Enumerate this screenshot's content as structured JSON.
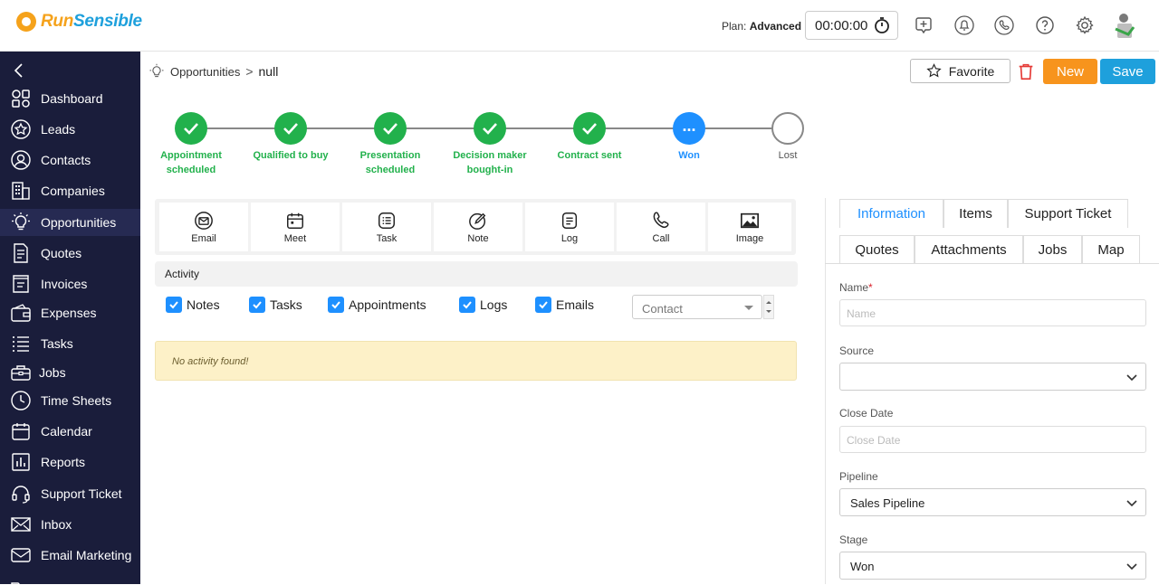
{
  "brand": {
    "part1": "Run",
    "part2": "Sensible"
  },
  "header": {
    "plan_label": "Plan:",
    "plan_value": "Advanced",
    "timer": "00:00:00"
  },
  "sidebar": {
    "items": [
      {
        "label": "Dashboard",
        "icon": "dashboard-icon"
      },
      {
        "label": "Leads",
        "icon": "star-icon"
      },
      {
        "label": "Contacts",
        "icon": "contact-icon"
      },
      {
        "label": "Companies",
        "icon": "building-icon"
      },
      {
        "label": "Opportunities",
        "icon": "lightbulb-icon",
        "active": true
      },
      {
        "label": "Quotes",
        "icon": "document-icon"
      },
      {
        "label": "Invoices",
        "icon": "invoice-icon"
      },
      {
        "label": "Expenses",
        "icon": "wallet-icon"
      },
      {
        "label": "Tasks",
        "icon": "list-icon"
      },
      {
        "label": "Jobs",
        "icon": "toolbox-icon"
      },
      {
        "label": "Time Sheets",
        "icon": "clock-icon"
      },
      {
        "label": "Calendar",
        "icon": "calendar-icon"
      },
      {
        "label": "Reports",
        "icon": "report-icon"
      },
      {
        "label": "Support Ticket",
        "icon": "headset-icon"
      },
      {
        "label": "Inbox",
        "icon": "mail-icon"
      },
      {
        "label": "Email Marketing",
        "icon": "email-marketing-icon"
      }
    ]
  },
  "breadcrumb": {
    "section": "Opportunities",
    "current": "null"
  },
  "toolbar": {
    "favorite_label": "Favorite",
    "new_label": "New",
    "save_label": "Save"
  },
  "pipeline": {
    "stages": [
      {
        "label": "Appointment scheduled",
        "state": "done"
      },
      {
        "label": "Qualified to buy",
        "state": "done"
      },
      {
        "label": "Presentation scheduled",
        "state": "done"
      },
      {
        "label": "Decision maker bought-in",
        "state": "done"
      },
      {
        "label": "Contract sent",
        "state": "done"
      },
      {
        "label": "Won",
        "state": "current",
        "symbol": "..."
      },
      {
        "label": "Lost",
        "state": "todo"
      }
    ]
  },
  "actions": [
    {
      "label": "Email",
      "icon": "envelope-icon"
    },
    {
      "label": "Meet",
      "icon": "calendar-meet-icon"
    },
    {
      "label": "Task",
      "icon": "task-list-icon"
    },
    {
      "label": "Note",
      "icon": "pencil-icon"
    },
    {
      "label": "Log",
      "icon": "log-icon"
    },
    {
      "label": "Call",
      "icon": "phone-icon"
    },
    {
      "label": "Image",
      "icon": "image-icon"
    }
  ],
  "activity": {
    "title": "Activity",
    "filters": [
      "Notes",
      "Tasks",
      "Appointments",
      "Logs",
      "Emails"
    ],
    "contact_placeholder": "Contact",
    "empty_message": "No activity found!"
  },
  "tabs": {
    "row1": [
      {
        "label": "Information",
        "active": true
      },
      {
        "label": "Items"
      },
      {
        "label": "Support Ticket"
      }
    ],
    "row2": [
      {
        "label": "Quotes"
      },
      {
        "label": "Attachments"
      },
      {
        "label": "Jobs"
      },
      {
        "label": "Map"
      }
    ]
  },
  "form": {
    "name_label": "Name",
    "name_required": "*",
    "name_placeholder": "Name",
    "source_label": "Source",
    "source_value": "",
    "close_date_label": "Close Date",
    "close_date_placeholder": "Close Date",
    "pipeline_label": "Pipeline",
    "pipeline_value": "Sales Pipeline",
    "stage_label": "Stage",
    "stage_value": "Won"
  },
  "colors": {
    "sidebar_bg": "#1a1d3b",
    "done": "#22b14c",
    "current": "#1e90ff",
    "new_button": "#f7941d",
    "save_button": "#1ea0dc",
    "brand_orange": "#f5a21b",
    "brand_blue": "#1ea0dc"
  }
}
